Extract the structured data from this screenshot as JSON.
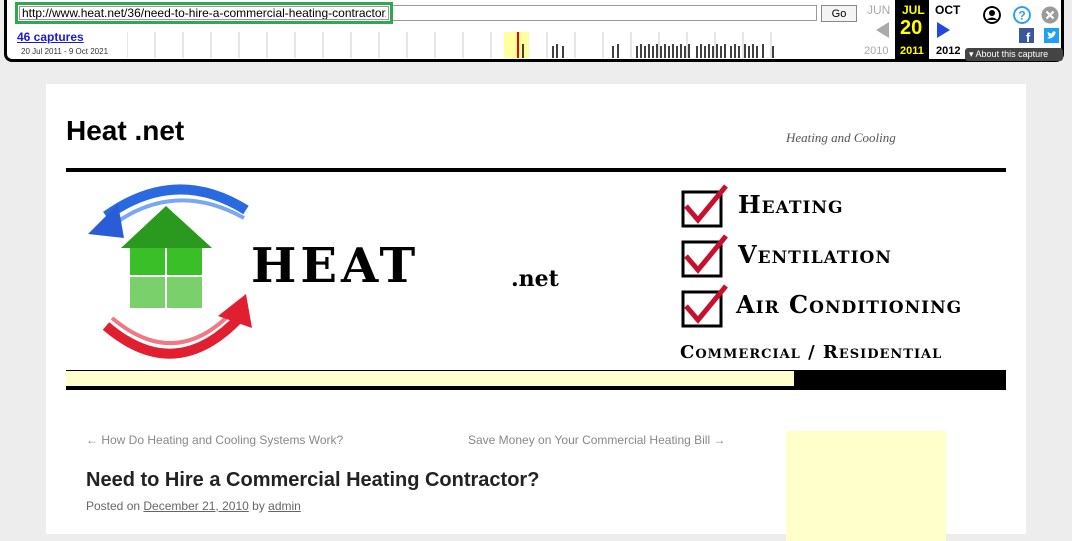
{
  "wayback": {
    "url": "http://www.heat.net/36/need-to-hire-a-commercial-heating-contractor/",
    "go_label": "Go",
    "captures": "46 captures",
    "range": "20 Jul 2011 - 9 Oct 2021",
    "months": {
      "prev": "JUN",
      "current": "JUL",
      "next": "OCT"
    },
    "day": "20",
    "years": {
      "prev": "2010",
      "current": "2011",
      "next": "2012"
    },
    "about": "About this capture"
  },
  "site": {
    "title": "Heat .net",
    "tagline": "Heating and Cooling",
    "logo_word": "HEAT",
    "logo_suffix": ".net",
    "services": [
      "Heating",
      "Ventilation",
      "Air Conditioning"
    ],
    "segments": "Commercial / Residential"
  },
  "post_nav": {
    "prev": "← How Do Heating and Cooling Systems Work?",
    "next": "Save Money on Your Commercial Heating Bill →"
  },
  "post": {
    "title": "Need to Hire a Commercial Heating Contractor?",
    "posted_on_label": "Posted on",
    "date": "December 21, 2010",
    "by_label": "by",
    "author": "admin"
  }
}
